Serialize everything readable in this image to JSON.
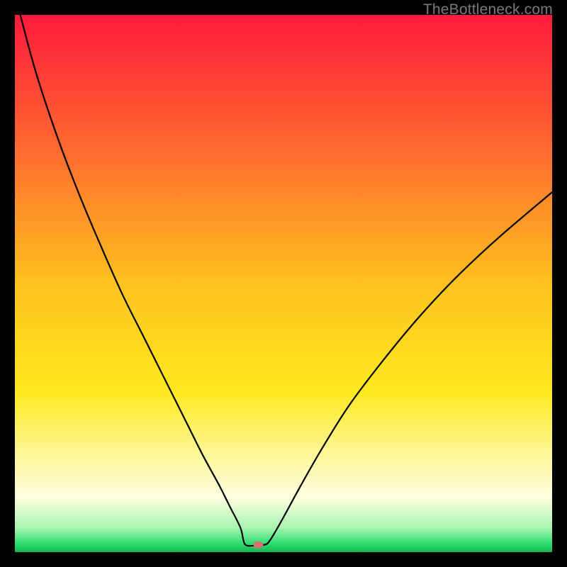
{
  "watermark": "TheBottleneck.com",
  "chart_data": {
    "type": "line",
    "title": "",
    "xlabel": "",
    "ylabel": "",
    "xlim": [
      0,
      100
    ],
    "ylim": [
      0,
      100
    ],
    "background_gradient": {
      "stops": [
        {
          "offset": 0.0,
          "color": "#ff1a3c"
        },
        {
          "offset": 0.25,
          "color": "#ff6a2f"
        },
        {
          "offset": 0.5,
          "color": "#ffc21f"
        },
        {
          "offset": 0.7,
          "color": "#ffe91f"
        },
        {
          "offset": 0.82,
          "color": "#fff79a"
        },
        {
          "offset": 0.9,
          "color": "#fdffe0"
        },
        {
          "offset": 0.955,
          "color": "#a7f5b0"
        },
        {
          "offset": 0.985,
          "color": "#2bdc6e"
        },
        {
          "offset": 1.0,
          "color": "#17b351"
        }
      ]
    },
    "series": [
      {
        "name": "bottleneck-curve",
        "color": "#000000",
        "width": 2.2,
        "x": [
          1,
          4,
          8,
          12,
          16,
          20,
          24,
          28,
          32,
          35,
          38,
          40,
          42,
          42.8,
          44.5,
          46,
          47,
          48,
          50,
          53,
          57,
          62,
          68,
          75,
          82,
          90,
          100
        ],
        "y": [
          100,
          89,
          77,
          66.5,
          57,
          48,
          40,
          32,
          24,
          18,
          12.5,
          8.5,
          4.5,
          1.5,
          1.2,
          1.3,
          1.6,
          3.0,
          6.5,
          12,
          19,
          27,
          35,
          43.5,
          51,
          58.5,
          67
        ]
      }
    ],
    "marker": {
      "name": "optimal-point",
      "x": 45.3,
      "y": 1.35,
      "rx": 7,
      "ry": 5,
      "fill": "#d4726b"
    },
    "flat_segment": {
      "x0": 42.8,
      "x1": 46.5,
      "y": 1.25
    }
  }
}
